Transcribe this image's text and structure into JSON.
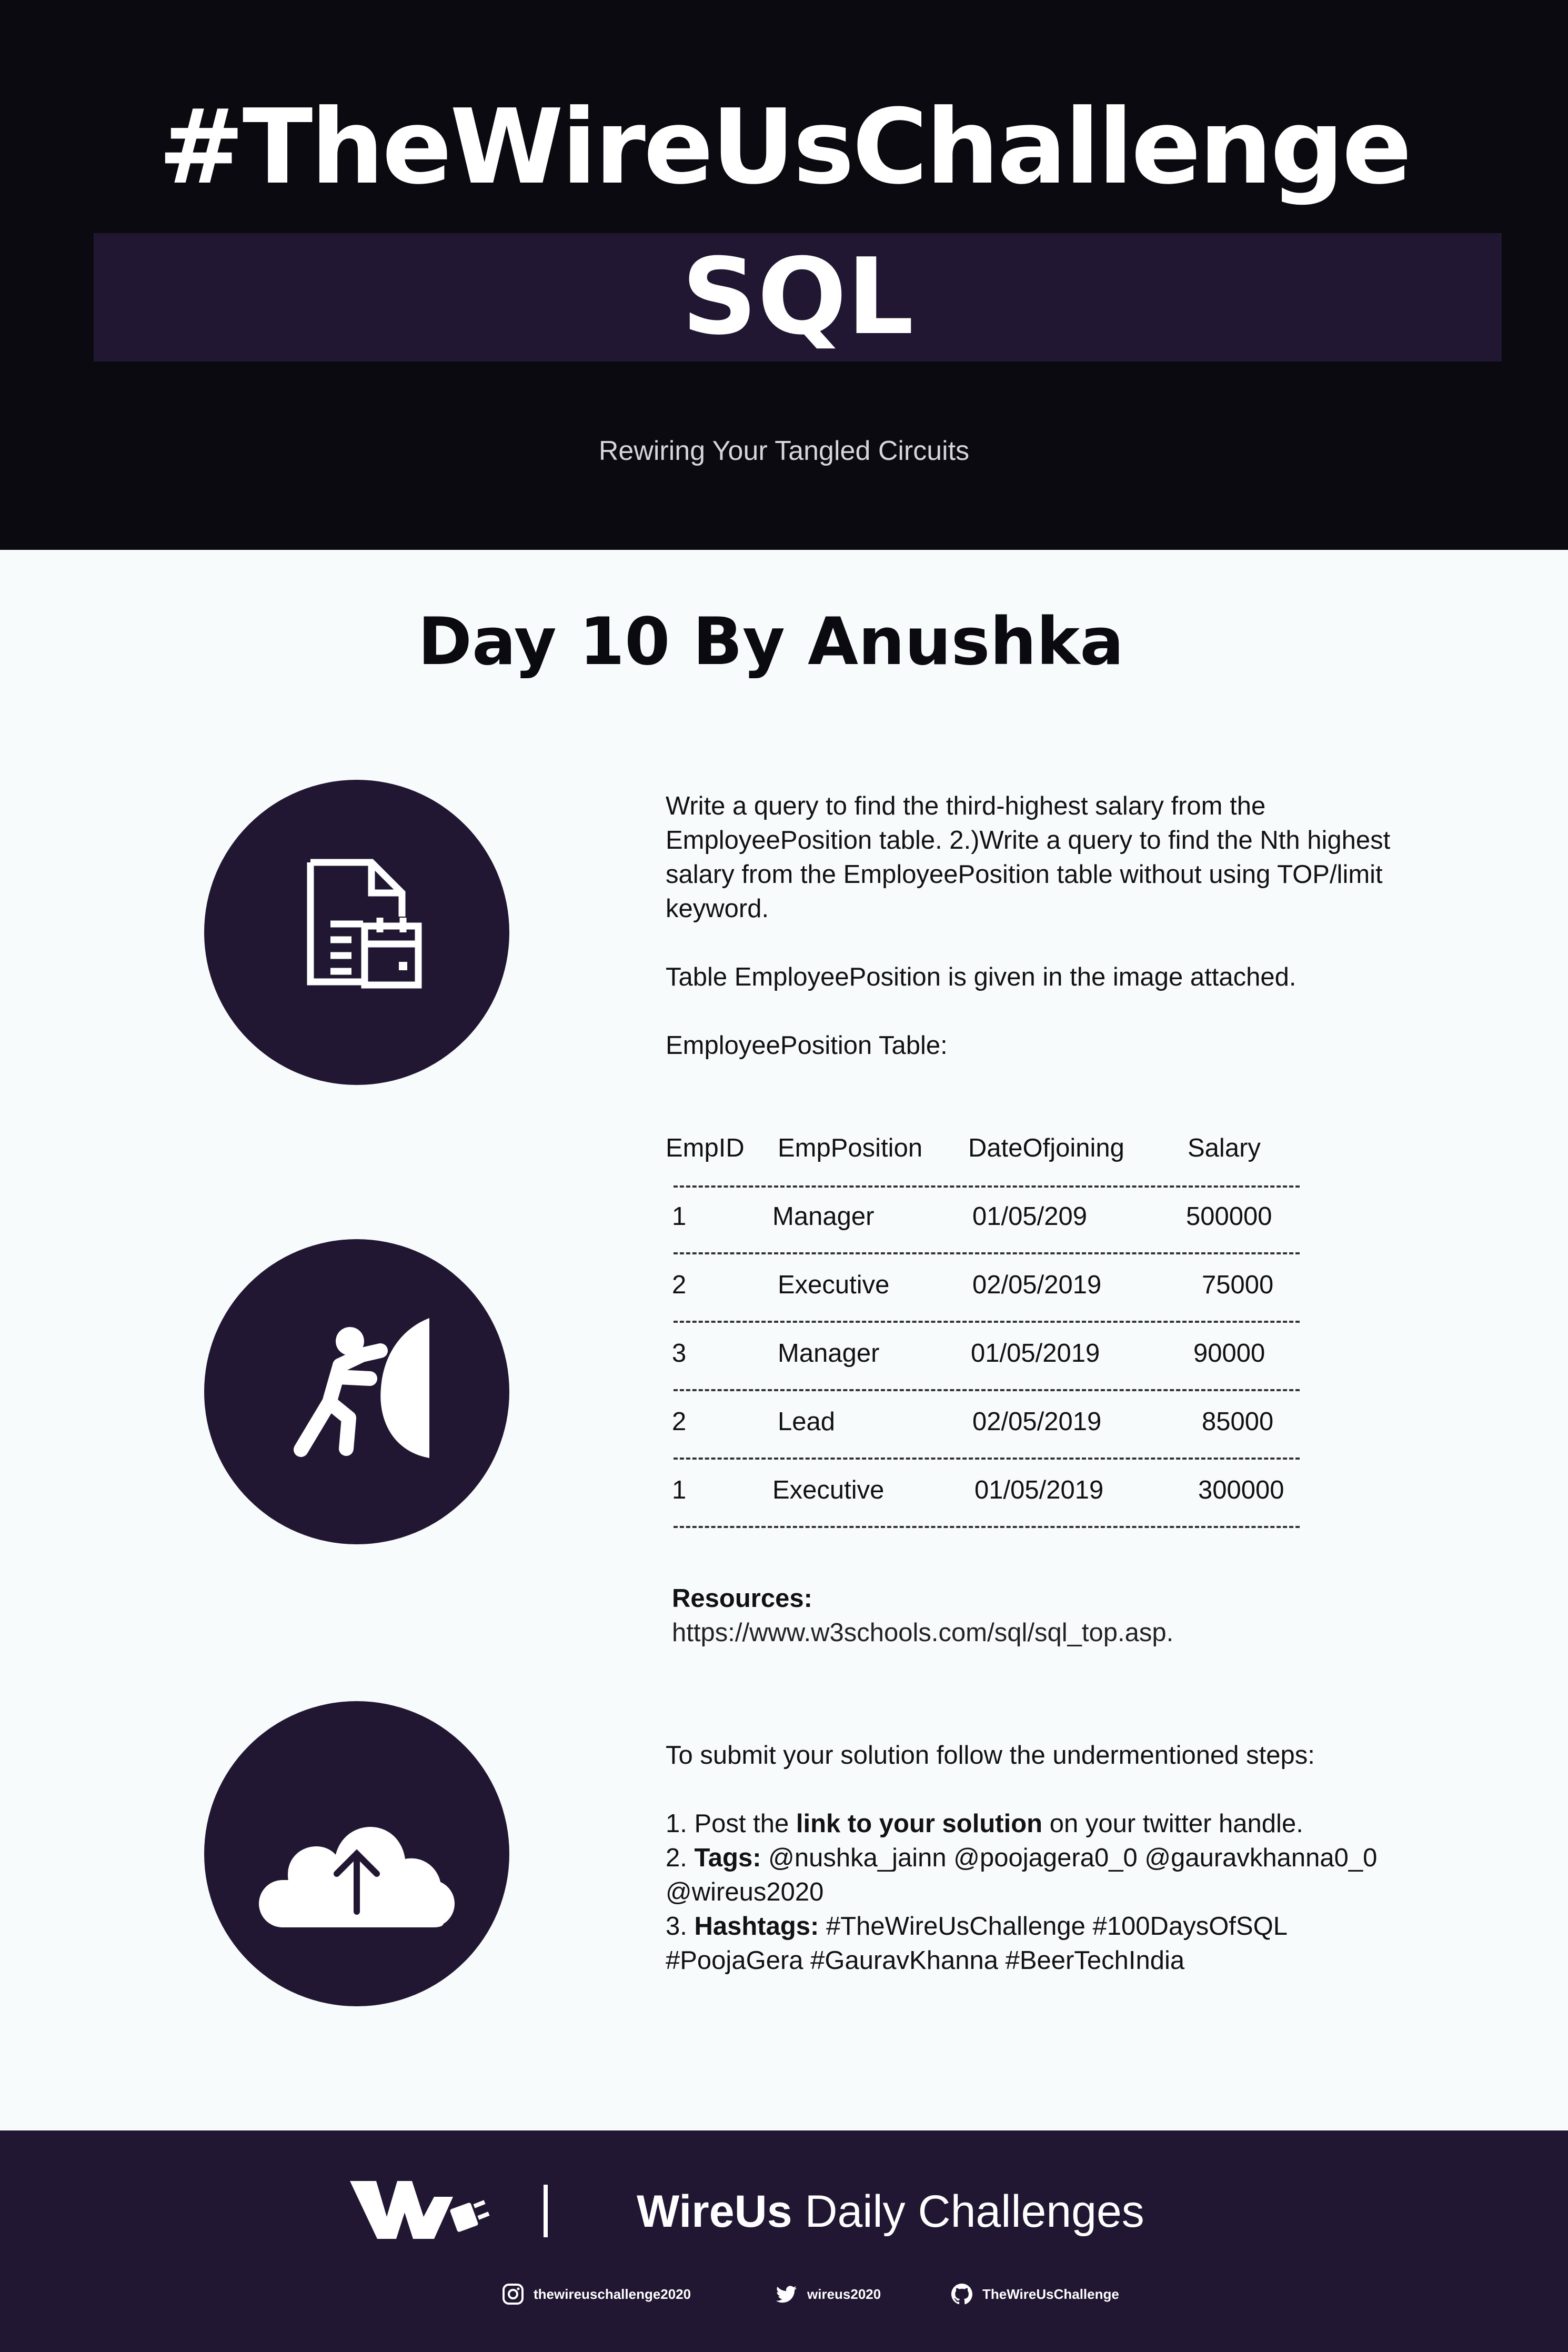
{
  "header": {
    "title": "#TheWireUsChallenge",
    "subject": "SQL",
    "tagline": "Rewiring Your Tangled Circuits"
  },
  "day_title": "Day 10 By Anushka",
  "task": {
    "paragraph1": "Write a query to find the third-highest salary from the EmployeePosition table. 2.)Write a query to find the Nth highest salary from the EmployeePosition table without using TOP/limit keyword.",
    "paragraph2": "Table EmployeePosition is given in the image attached.",
    "paragraph3": "EmployeePosition Table:"
  },
  "table": {
    "columns": [
      "EmpID",
      "EmpPosition",
      "DateOfjoining",
      "Salary"
    ],
    "rows": [
      [
        "1",
        "Manager",
        "01/05/209",
        "500000"
      ],
      [
        "2",
        "Executive",
        "02/05/2019",
        "75000"
      ],
      [
        "3",
        "Manager",
        "01/05/2019",
        "90000"
      ],
      [
        "2",
        "Lead",
        "02/05/2019",
        "85000"
      ],
      [
        "1",
        "Executive",
        "01/05/2019",
        "300000"
      ]
    ]
  },
  "resources": {
    "label": "Resources:",
    "link": "https://www.w3schools.com/sql/sql_top.asp."
  },
  "submit": {
    "intro": "To submit your solution follow the undermentioned steps:",
    "step1_prefix": "1. Post the ",
    "step1_bold": "link to your solution",
    "step1_suffix": " on your twitter handle.",
    "step2_prefix": "2. ",
    "step2_bold": "Tags:",
    "step2_text": " @nushka_jainn @poojagera0_0 @gauravkhanna0_0 @wireus2020",
    "step3_prefix": "3. ",
    "step3_bold": "Hashtags:",
    "step3_text": " #TheWireUsChallenge #100DaysOfSQL #PoojaGera #GauravKhanna #BeerTechIndia"
  },
  "icons": [
    "document-calendar-icon",
    "person-pushing-wall-icon",
    "cloud-upload-icon",
    "wireus-logo",
    "instagram-icon",
    "twitter-icon",
    "github-icon"
  ],
  "colors": {
    "dark": "#0b0a10",
    "purple": "#211733",
    "background": "#f7fbfc"
  },
  "footer": {
    "brand_bold": "WireUs",
    "brand_rest": " Daily Challenges",
    "instagram": "thewireuschallenge2020",
    "twitter": "wireus2020",
    "github": "TheWireUsChallenge"
  }
}
